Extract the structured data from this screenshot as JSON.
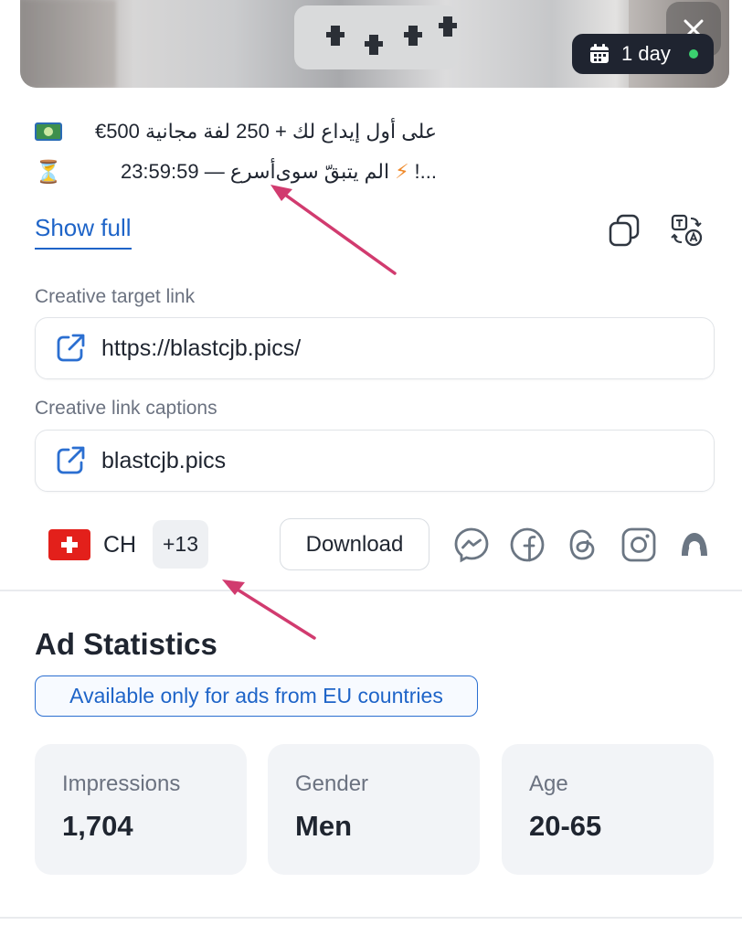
{
  "ad": {
    "duration_label": "1 day",
    "description_line1": "على أول إيداع لك + 250 لفة مجانية 500€",
    "description_line2_start": "أسرع — 23:59:59 ",
    "description_line2_mid": "الم يتبقّ سوى",
    "description_line2_end": "!...",
    "show_full_label": "Show full"
  },
  "target_link": {
    "label": "Creative target link",
    "value": "https://blastcjb.pics/"
  },
  "link_caption": {
    "label": "Creative link captions",
    "value": "blastcjb.pics"
  },
  "geo": {
    "country_code": "CH",
    "more_count": "+13"
  },
  "actions": {
    "download_label": "Download"
  },
  "stats": {
    "title": "Ad Statistics",
    "notice": "Available only for ads from EU countries",
    "cards": [
      {
        "label": "Impressions",
        "value": "1,704"
      },
      {
        "label": "Gender",
        "value": "Men"
      },
      {
        "label": "Age",
        "value": "20-65"
      }
    ]
  },
  "icons": [
    "close-icon",
    "calendar-icon",
    "copy-icon",
    "translate-icon",
    "external-link-icon",
    "messenger-icon",
    "facebook-icon",
    "threads-icon",
    "instagram-icon",
    "audience-network-icon"
  ],
  "colors": {
    "accent": "#1e64c8",
    "status_online": "#3bd16f",
    "annotation_arrow": "#d13b6f"
  }
}
